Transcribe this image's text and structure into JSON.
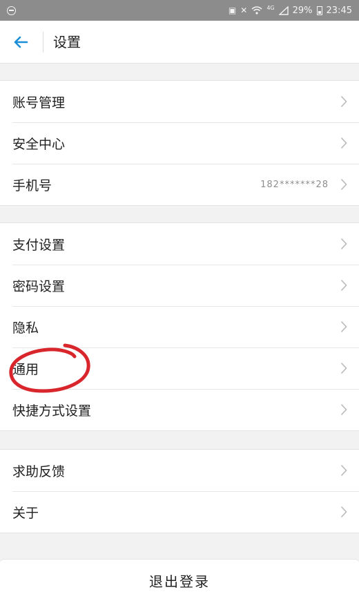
{
  "status_bar": {
    "network": "4G",
    "battery": "29%",
    "time": "23:45"
  },
  "header": {
    "title": "设置",
    "back_icon": "arrow-left-icon",
    "accent_color": "#1a8fd8"
  },
  "groups": [
    {
      "items": [
        {
          "label": "账号管理",
          "value": ""
        },
        {
          "label": "安全中心",
          "value": ""
        },
        {
          "label": "手机号",
          "value": "182*******28"
        }
      ]
    },
    {
      "items": [
        {
          "label": "支付设置",
          "value": ""
        },
        {
          "label": "密码设置",
          "value": ""
        },
        {
          "label": "隐私",
          "value": ""
        },
        {
          "label": "通用",
          "value": ""
        },
        {
          "label": "快捷方式设置",
          "value": ""
        }
      ]
    },
    {
      "items": [
        {
          "label": "求助反馈",
          "value": ""
        },
        {
          "label": "关于",
          "value": ""
        }
      ]
    }
  ],
  "logout_label": "退出登录",
  "annotation_color": "#d8262c"
}
